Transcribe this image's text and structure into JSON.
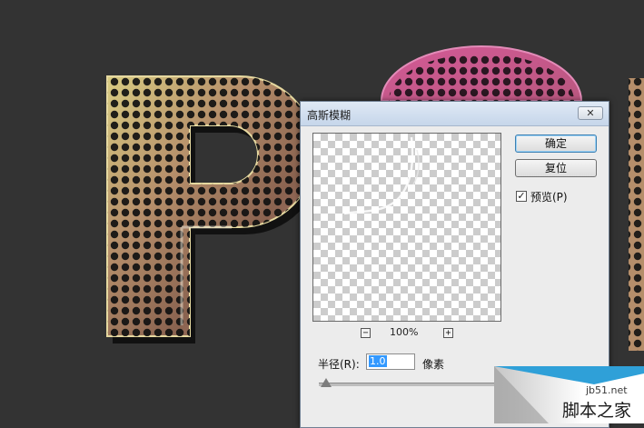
{
  "dialog": {
    "title": "高斯模糊",
    "close_glyph": "✕",
    "ok_label": "确定",
    "reset_label": "复位",
    "preview_label": "预览(P)",
    "preview_checked": true,
    "check_glyph": "✓",
    "zoom_out_glyph": "−",
    "zoom_in_glyph": "+",
    "zoom_level": "100%",
    "radius_label": "半径(R):",
    "radius_value": "1.0",
    "radius_unit": "像素"
  },
  "watermark": {
    "site": "jb51.net",
    "text": "脚本之家"
  },
  "colors": {
    "workspace_bg": "#333333",
    "dialog_bg": "#ececec",
    "title_bar": "#c6d6ea",
    "selection_highlight": "#3399ff"
  }
}
